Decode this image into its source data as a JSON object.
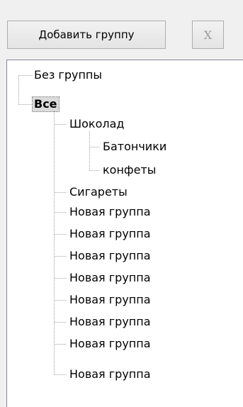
{
  "toolbar": {
    "add_group_label": "Добавить группу",
    "close_label": "X"
  },
  "tree": {
    "root_items": [
      {
        "label": "Без группы",
        "selected": false
      },
      {
        "label": "Все",
        "selected": true
      }
    ],
    "all_children": [
      {
        "label": "Шоколад",
        "children": [
          "Батончики",
          "конфеты"
        ]
      },
      {
        "label": "Сигареты"
      },
      {
        "label": "Новая группа"
      },
      {
        "label": "Новая группа"
      },
      {
        "label": "Новая группа"
      },
      {
        "label": "Новая группа"
      },
      {
        "label": "Новая группа"
      },
      {
        "label": "Новая группа"
      },
      {
        "label": "Новая группа"
      },
      {
        "label": "Новая группа"
      }
    ]
  }
}
